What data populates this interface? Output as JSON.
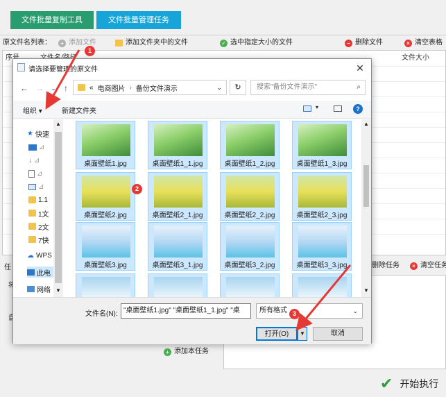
{
  "tabs": [
    "文件批量复制工具",
    "文件批量管理任务"
  ],
  "toolbar": {
    "list_label": "原文件名列表：",
    "add_file": "添加文件",
    "add_folder_files": "添加文件夹中的文件",
    "select_by_size": "选中指定大小的文件",
    "delete_file": "删除文件",
    "clear_table": "清空表格"
  },
  "table_headers": [
    "序号",
    "文件名/路径",
    "文件大小"
  ],
  "task_bar": {
    "delete_task": "删除任务",
    "clear_task": "清空任务"
  },
  "side_labels": [
    "任",
    "将",
    "自"
  ],
  "add_task": "添加本任务",
  "start": "开始执行",
  "dialog": {
    "title": "请选择要管理的原文件",
    "breadcrumb": [
      "«",
      "电商图片",
      "备份文件演示"
    ],
    "search_placeholder": "搜索\"备份文件演示\"",
    "organize": "组织 ▾",
    "new_folder": "新建文件夹",
    "sidebar": [
      "快速",
      "1.1",
      "1文",
      "2文",
      "7快",
      "WPS",
      "此电",
      "网络"
    ],
    "files": [
      {
        "name": "桌面壁纸1.jpg",
        "thumb": "green"
      },
      {
        "name": "桌面壁纸1_1.jpg",
        "thumb": "green"
      },
      {
        "name": "桌面壁纸1_2.jpg",
        "thumb": "green"
      },
      {
        "name": "桌面壁纸1_3.jpg",
        "thumb": "green"
      },
      {
        "name": "桌面壁纸2.jpg",
        "thumb": "yellow"
      },
      {
        "name": "桌面壁纸2_1.jpg",
        "thumb": "yellow"
      },
      {
        "name": "桌面壁纸2_2.jpg",
        "thumb": "yellow"
      },
      {
        "name": "桌面壁纸2_3.jpg",
        "thumb": "yellow"
      },
      {
        "name": "桌面壁纸3.jpg",
        "thumb": "blue"
      },
      {
        "name": "桌面壁纸3_1.jpg",
        "thumb": "blue"
      },
      {
        "name": "桌面壁纸3_2.jpg",
        "thumb": "blue"
      },
      {
        "name": "桌面壁纸3_3.jpg",
        "thumb": "blue"
      },
      {
        "name": "",
        "thumb": "cloud"
      },
      {
        "name": "",
        "thumb": "cloud"
      },
      {
        "name": "",
        "thumb": "cloud"
      },
      {
        "name": "",
        "thumb": "cloud"
      }
    ],
    "filename_label": "文件名(N):",
    "filename_value": "\"桌面壁纸1.jpg\" \"桌面壁纸1_1.jpg\" \"桌",
    "filter": "所有格式",
    "open": "打开(O)",
    "cancel": "取消"
  },
  "badges": [
    "1",
    "2",
    "3"
  ],
  "colors": {
    "tab_green": "#2a9d70",
    "tab_blue": "#17a4d8",
    "arrow": "#e53935",
    "selection": "#cce8ff"
  }
}
